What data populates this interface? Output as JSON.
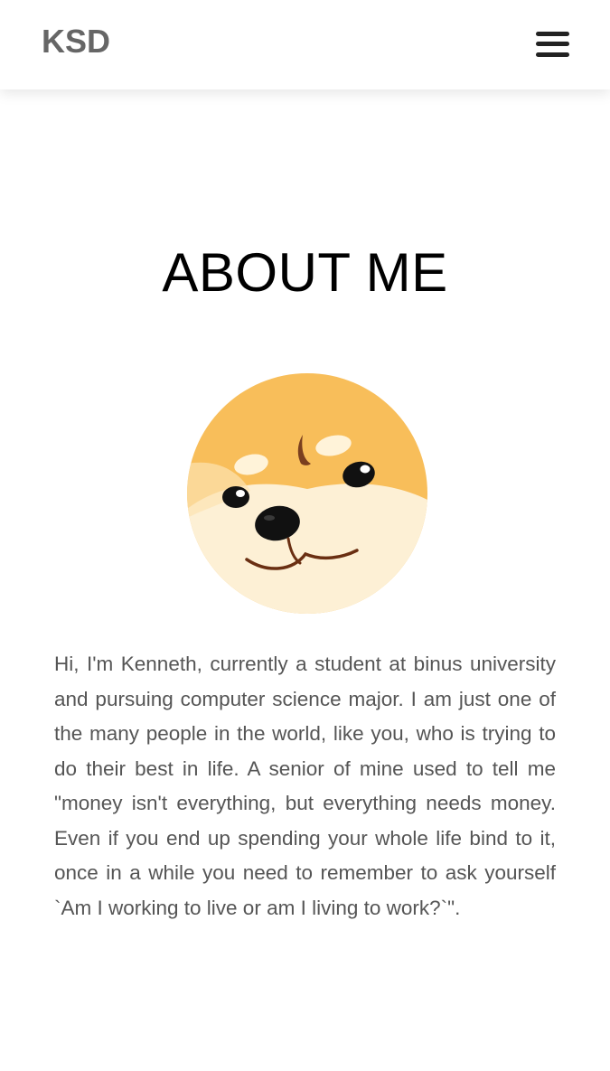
{
  "header": {
    "logo": "KSD",
    "menu_icon": "hamburger-menu-icon"
  },
  "main": {
    "title": "ABOUT ME",
    "avatar_icon": "shiba-dog-face-avatar",
    "bio": "Hi, I'm Kenneth, currently a student at binus university and pursuing computer science major. I am just one of the many people in the world, like you, who is trying to do their best in life. A senior of mine used to tell me \"money isn't everything, but everything needs money. Even if you end up spending your whole life bind to it, once in a while you need to remember to ask yourself `Am I working to live or am I living to work?`\"."
  },
  "colors": {
    "logo": "#666666",
    "title": "#000000",
    "bio_text": "#555555",
    "avatar_fur": "#F8BE5A",
    "avatar_cream": "#FDF0D5"
  }
}
